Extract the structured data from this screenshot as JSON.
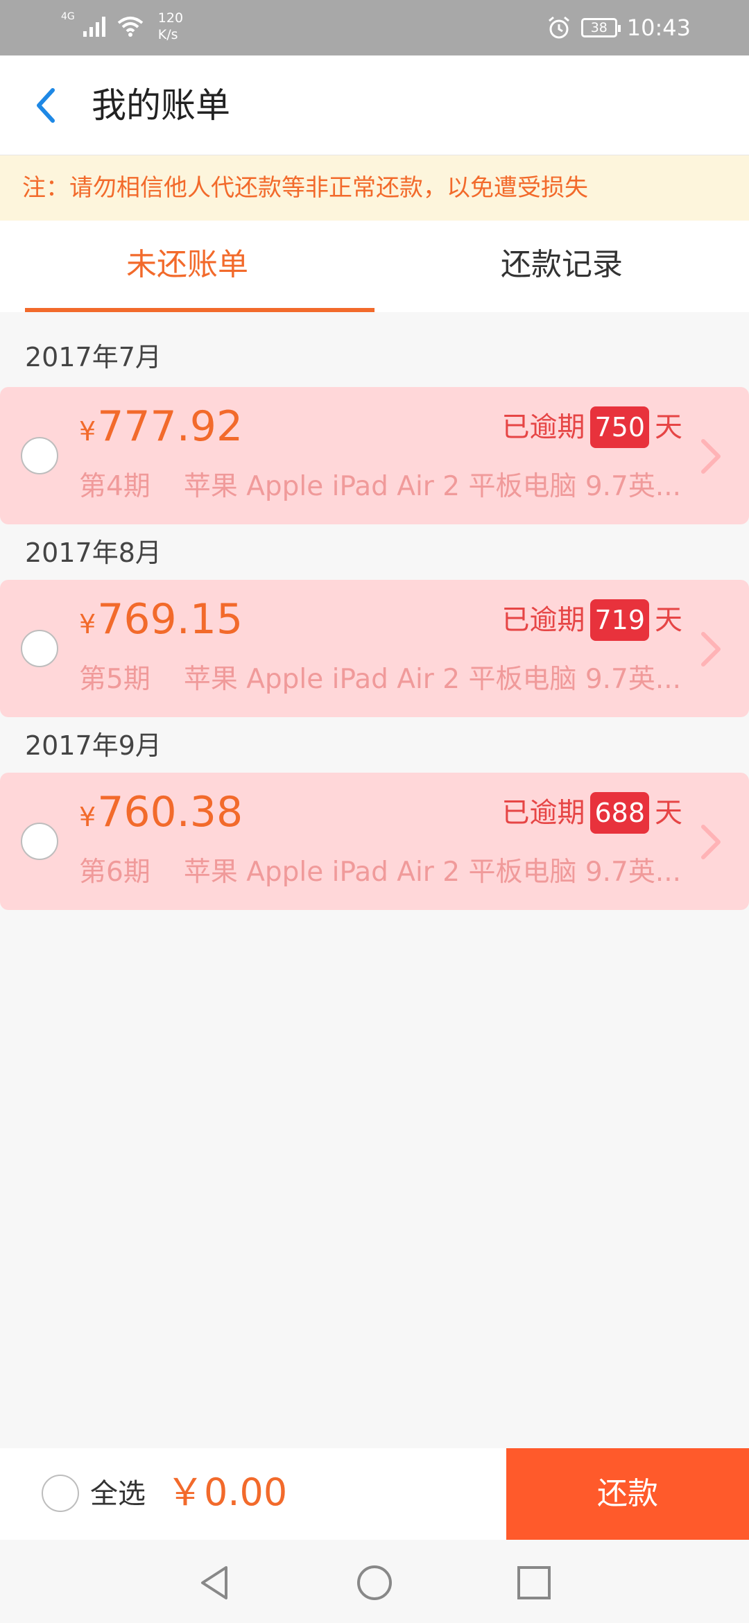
{
  "status_bar": {
    "network": "4G",
    "speed_value": "120",
    "speed_unit": "K/s",
    "battery": "38",
    "time": "10:43"
  },
  "header": {
    "title": "我的账单"
  },
  "notice": {
    "text": "注：请勿相信他人代还款等非正常还款，以免遭受损失"
  },
  "tabs": [
    {
      "label": "未还账单",
      "active": true
    },
    {
      "label": "还款记录",
      "active": false
    }
  ],
  "bills": [
    {
      "month": "2017年7月",
      "currency": "¥",
      "amount": "777.92",
      "overdue_prefix": "已逾期",
      "overdue_days": "750",
      "overdue_suffix": "天",
      "period": "第4期",
      "product": "苹果 Apple iPad Air 2 平板电脑 9.7英..."
    },
    {
      "month": "2017年8月",
      "currency": "¥",
      "amount": "769.15",
      "overdue_prefix": "已逾期",
      "overdue_days": "719",
      "overdue_suffix": "天",
      "period": "第5期",
      "product": "苹果 Apple iPad Air 2 平板电脑 9.7英..."
    },
    {
      "month": "2017年9月",
      "currency": "¥",
      "amount": "760.38",
      "overdue_prefix": "已逾期",
      "overdue_days": "688",
      "overdue_suffix": "天",
      "period": "第6期",
      "product": "苹果 Apple iPad Air 2 平板电脑 9.7英..."
    }
  ],
  "pay_bar": {
    "select_all_label": "全选",
    "total": "￥0.00",
    "pay_button_label": "还款"
  },
  "colors": {
    "accent": "#f26a2b",
    "overdue_badge": "#e8323c",
    "card_bg": "#ffd7d9",
    "pay_button": "#ff5a2b"
  }
}
